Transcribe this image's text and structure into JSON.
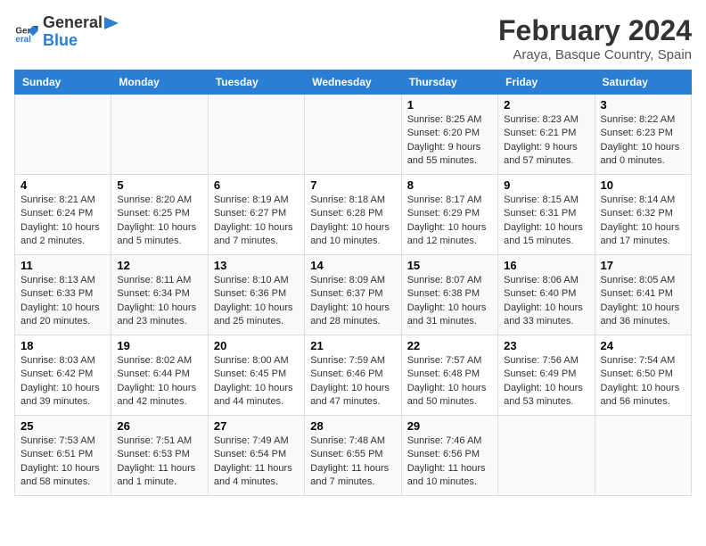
{
  "header": {
    "logo_line1": "General",
    "logo_line2": "Blue",
    "title": "February 2024",
    "subtitle": "Araya, Basque Country, Spain"
  },
  "days_of_week": [
    "Sunday",
    "Monday",
    "Tuesday",
    "Wednesday",
    "Thursday",
    "Friday",
    "Saturday"
  ],
  "weeks": [
    [
      {
        "day": "",
        "info": ""
      },
      {
        "day": "",
        "info": ""
      },
      {
        "day": "",
        "info": ""
      },
      {
        "day": "",
        "info": ""
      },
      {
        "day": "1",
        "info": "Sunrise: 8:25 AM\nSunset: 6:20 PM\nDaylight: 9 hours\nand 55 minutes."
      },
      {
        "day": "2",
        "info": "Sunrise: 8:23 AM\nSunset: 6:21 PM\nDaylight: 9 hours\nand 57 minutes."
      },
      {
        "day": "3",
        "info": "Sunrise: 8:22 AM\nSunset: 6:23 PM\nDaylight: 10 hours\nand 0 minutes."
      }
    ],
    [
      {
        "day": "4",
        "info": "Sunrise: 8:21 AM\nSunset: 6:24 PM\nDaylight: 10 hours\nand 2 minutes."
      },
      {
        "day": "5",
        "info": "Sunrise: 8:20 AM\nSunset: 6:25 PM\nDaylight: 10 hours\nand 5 minutes."
      },
      {
        "day": "6",
        "info": "Sunrise: 8:19 AM\nSunset: 6:27 PM\nDaylight: 10 hours\nand 7 minutes."
      },
      {
        "day": "7",
        "info": "Sunrise: 8:18 AM\nSunset: 6:28 PM\nDaylight: 10 hours\nand 10 minutes."
      },
      {
        "day": "8",
        "info": "Sunrise: 8:17 AM\nSunset: 6:29 PM\nDaylight: 10 hours\nand 12 minutes."
      },
      {
        "day": "9",
        "info": "Sunrise: 8:15 AM\nSunset: 6:31 PM\nDaylight: 10 hours\nand 15 minutes."
      },
      {
        "day": "10",
        "info": "Sunrise: 8:14 AM\nSunset: 6:32 PM\nDaylight: 10 hours\nand 17 minutes."
      }
    ],
    [
      {
        "day": "11",
        "info": "Sunrise: 8:13 AM\nSunset: 6:33 PM\nDaylight: 10 hours\nand 20 minutes."
      },
      {
        "day": "12",
        "info": "Sunrise: 8:11 AM\nSunset: 6:34 PM\nDaylight: 10 hours\nand 23 minutes."
      },
      {
        "day": "13",
        "info": "Sunrise: 8:10 AM\nSunset: 6:36 PM\nDaylight: 10 hours\nand 25 minutes."
      },
      {
        "day": "14",
        "info": "Sunrise: 8:09 AM\nSunset: 6:37 PM\nDaylight: 10 hours\nand 28 minutes."
      },
      {
        "day": "15",
        "info": "Sunrise: 8:07 AM\nSunset: 6:38 PM\nDaylight: 10 hours\nand 31 minutes."
      },
      {
        "day": "16",
        "info": "Sunrise: 8:06 AM\nSunset: 6:40 PM\nDaylight: 10 hours\nand 33 minutes."
      },
      {
        "day": "17",
        "info": "Sunrise: 8:05 AM\nSunset: 6:41 PM\nDaylight: 10 hours\nand 36 minutes."
      }
    ],
    [
      {
        "day": "18",
        "info": "Sunrise: 8:03 AM\nSunset: 6:42 PM\nDaylight: 10 hours\nand 39 minutes."
      },
      {
        "day": "19",
        "info": "Sunrise: 8:02 AM\nSunset: 6:44 PM\nDaylight: 10 hours\nand 42 minutes."
      },
      {
        "day": "20",
        "info": "Sunrise: 8:00 AM\nSunset: 6:45 PM\nDaylight: 10 hours\nand 44 minutes."
      },
      {
        "day": "21",
        "info": "Sunrise: 7:59 AM\nSunset: 6:46 PM\nDaylight: 10 hours\nand 47 minutes."
      },
      {
        "day": "22",
        "info": "Sunrise: 7:57 AM\nSunset: 6:48 PM\nDaylight: 10 hours\nand 50 minutes."
      },
      {
        "day": "23",
        "info": "Sunrise: 7:56 AM\nSunset: 6:49 PM\nDaylight: 10 hours\nand 53 minutes."
      },
      {
        "day": "24",
        "info": "Sunrise: 7:54 AM\nSunset: 6:50 PM\nDaylight: 10 hours\nand 56 minutes."
      }
    ],
    [
      {
        "day": "25",
        "info": "Sunrise: 7:53 AM\nSunset: 6:51 PM\nDaylight: 10 hours\nand 58 minutes."
      },
      {
        "day": "26",
        "info": "Sunrise: 7:51 AM\nSunset: 6:53 PM\nDaylight: 11 hours\nand 1 minute."
      },
      {
        "day": "27",
        "info": "Sunrise: 7:49 AM\nSunset: 6:54 PM\nDaylight: 11 hours\nand 4 minutes."
      },
      {
        "day": "28",
        "info": "Sunrise: 7:48 AM\nSunset: 6:55 PM\nDaylight: 11 hours\nand 7 minutes."
      },
      {
        "day": "29",
        "info": "Sunrise: 7:46 AM\nSunset: 6:56 PM\nDaylight: 11 hours\nand 10 minutes."
      },
      {
        "day": "",
        "info": ""
      },
      {
        "day": "",
        "info": ""
      }
    ]
  ]
}
